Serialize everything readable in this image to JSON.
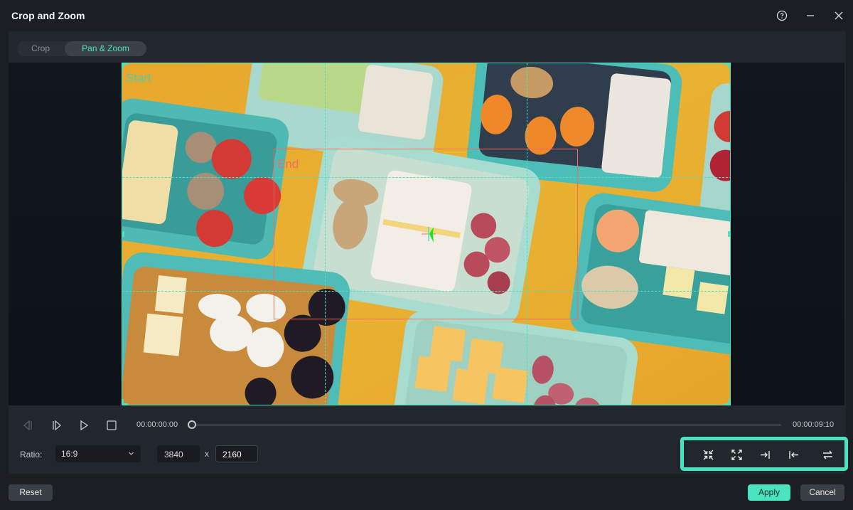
{
  "window": {
    "title": "Crop and Zoom",
    "help_icon": "question-circle-icon",
    "minimize_icon": "minimize-icon",
    "close_icon": "close-icon"
  },
  "tabs": [
    {
      "label": "Crop",
      "active": false
    },
    {
      "label": "Pan & Zoom",
      "active": true
    }
  ],
  "preview": {
    "start_label": "Start",
    "end_label": "End",
    "content": "Overhead photo of teal lunch boxes with sandwiches, fruit, nuts and cheese on a yellow background"
  },
  "playback": {
    "prev_frame_icon": "previous-frame-icon",
    "next_frame_icon": "next-frame-icon",
    "play_icon": "play-icon",
    "stop_icon": "stop-icon",
    "current_time": "00:00:00:00",
    "total_time": "00:00:09:10",
    "progress": 0
  },
  "settings": {
    "ratio_label": "Ratio:",
    "ratio_value": "16:9",
    "width": "3840",
    "times_sign": "x",
    "height": "2160"
  },
  "action_icons": [
    {
      "name": "shrink-icon",
      "title": "Shrink"
    },
    {
      "name": "expand-icon",
      "title": "Expand"
    },
    {
      "name": "set-end-icon",
      "title": "Set end"
    },
    {
      "name": "set-start-icon",
      "title": "Set start"
    },
    {
      "name": "swap-icon",
      "title": "Swap start and end"
    }
  ],
  "accent_color": "#4ae3c0",
  "end_color": "#ef6f5e",
  "footer": {
    "reset_label": "Reset",
    "apply_label": "Apply",
    "cancel_label": "Cancel"
  }
}
